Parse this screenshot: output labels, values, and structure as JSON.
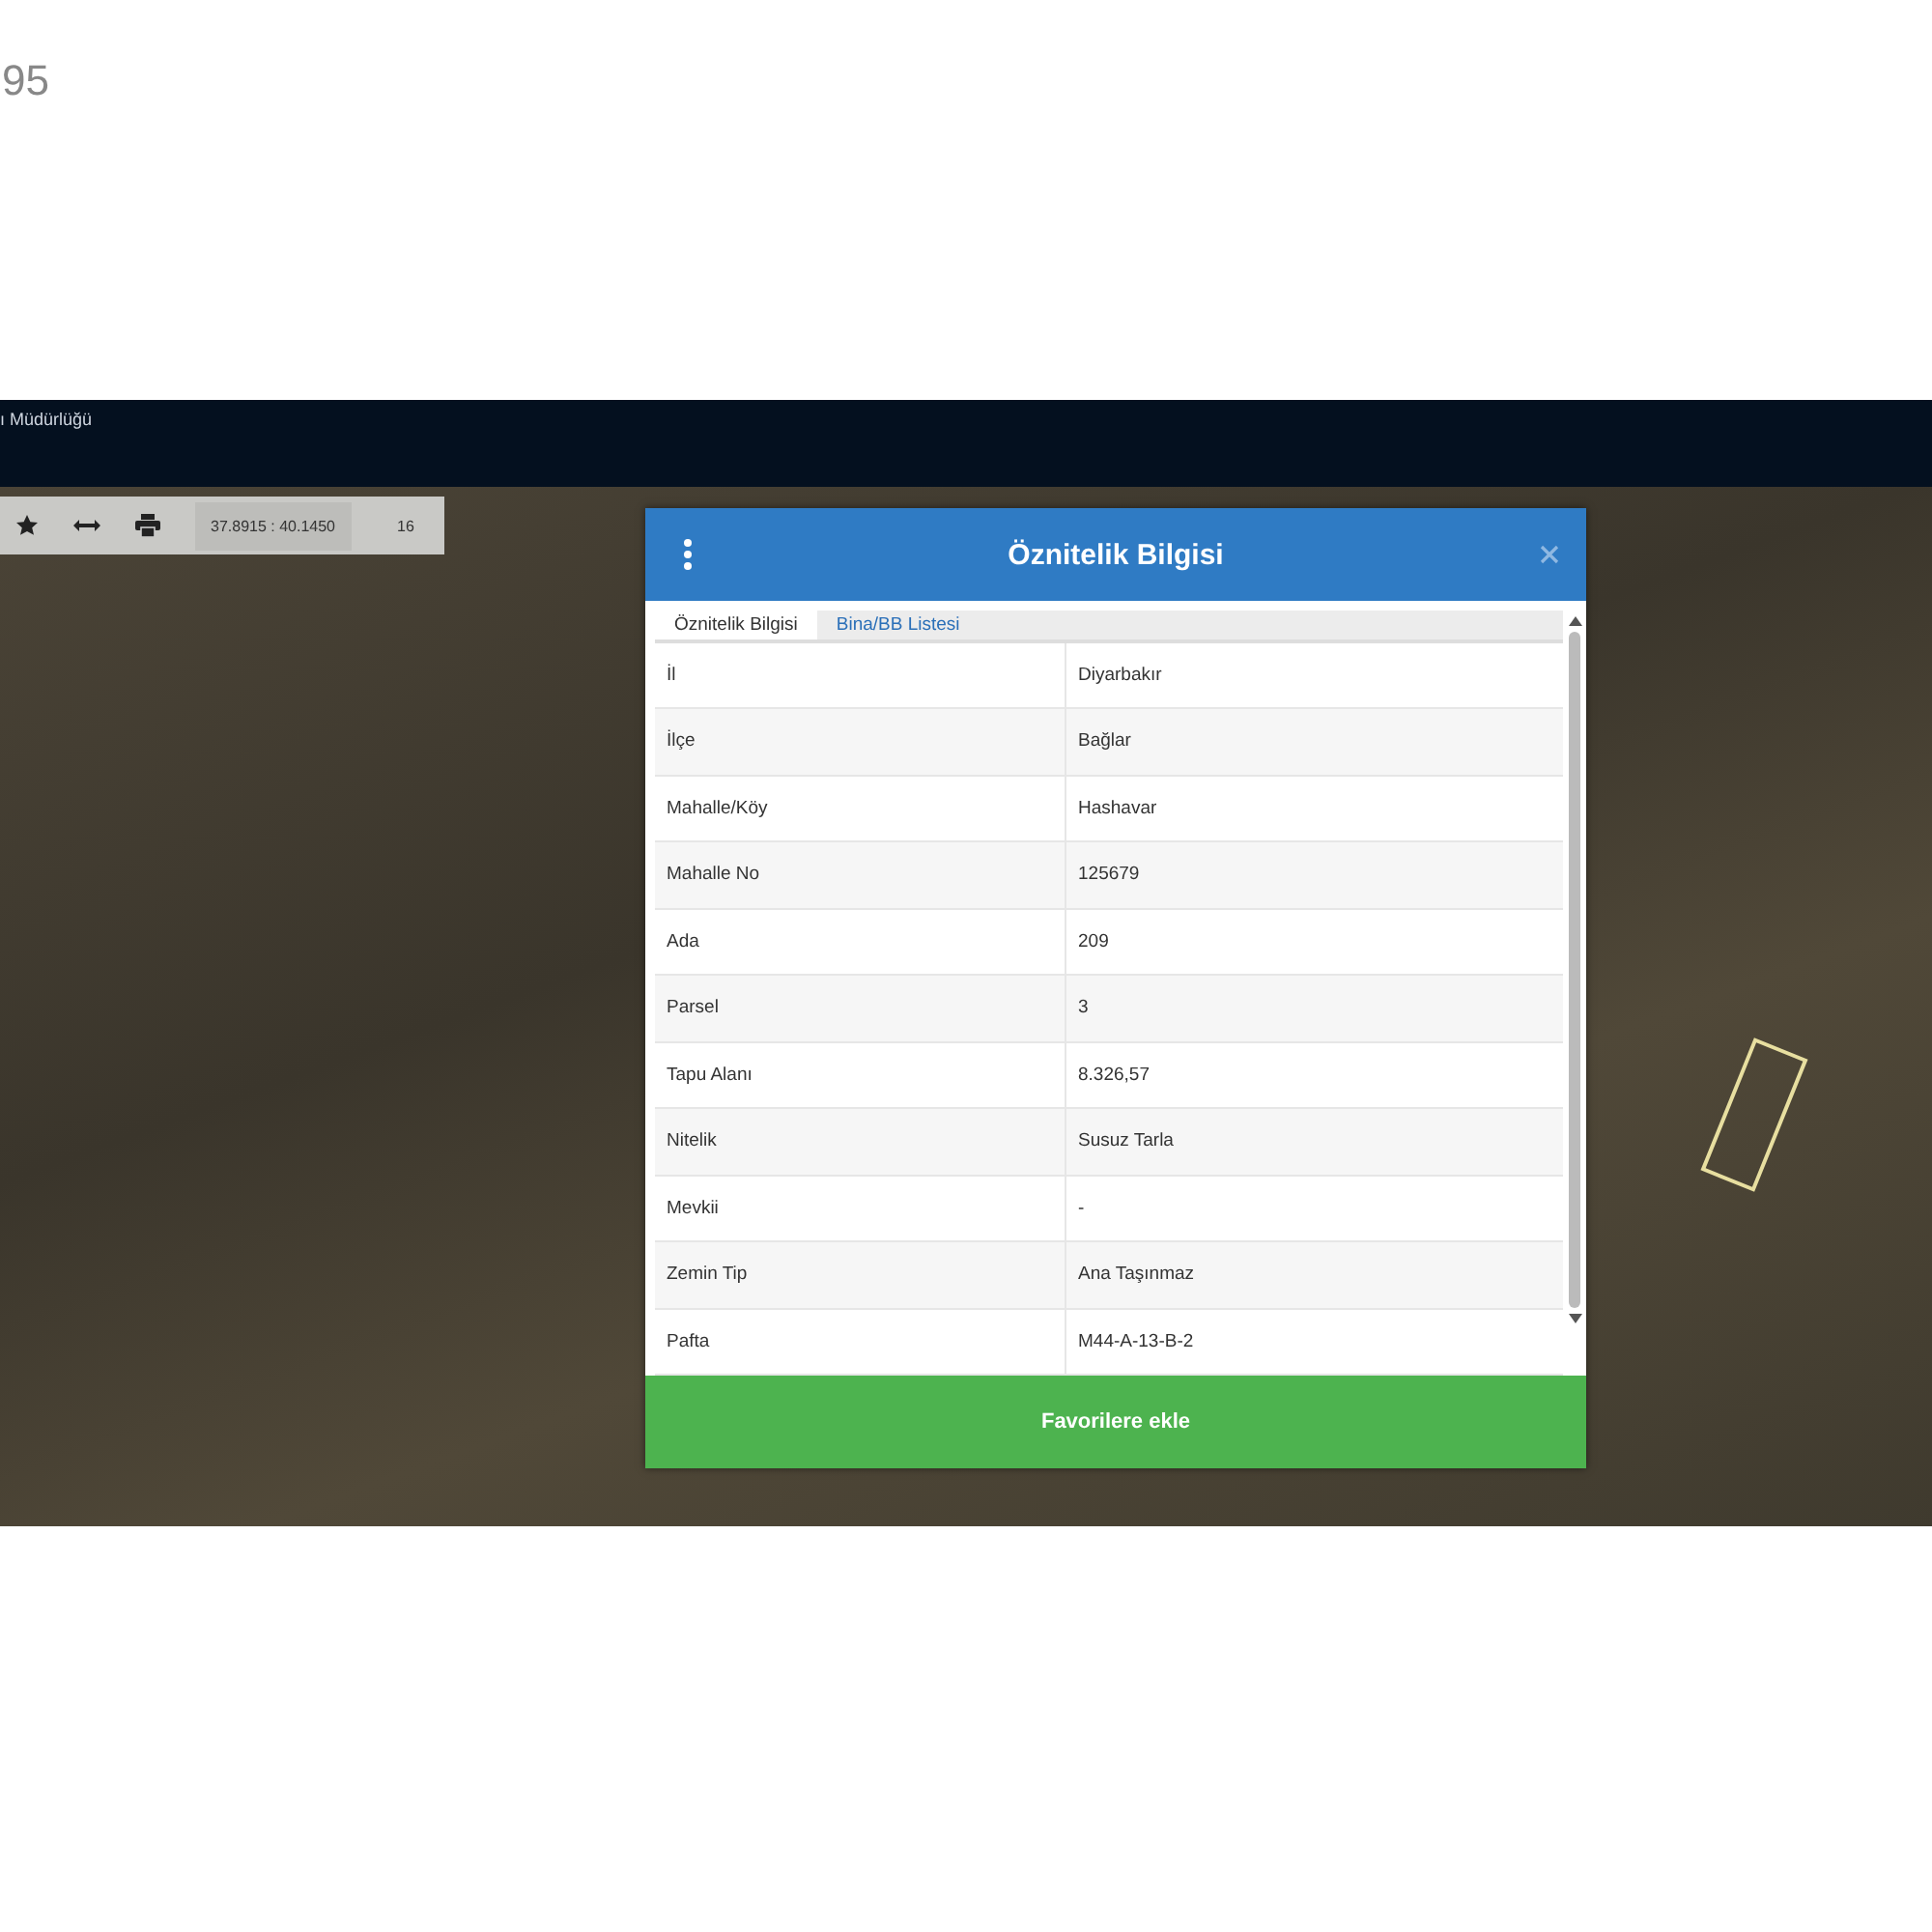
{
  "page_number": "95",
  "app_header": {
    "title": "ı Müdürlüğü"
  },
  "toolbar": {
    "coordinates": "37.8915 : 40.1450",
    "zoom": "16"
  },
  "dialog": {
    "title": "Öznitelik Bilgisi",
    "tabs": [
      {
        "label": "Öznitelik Bilgisi",
        "selected": true
      },
      {
        "label": "Bina/BB Listesi",
        "selected": false
      }
    ],
    "rows": [
      {
        "label": "İl",
        "value": "Diyarbakır"
      },
      {
        "label": "İlçe",
        "value": "Bağlar"
      },
      {
        "label": "Mahalle/Köy",
        "value": "Hashavar"
      },
      {
        "label": "Mahalle No",
        "value": "125679"
      },
      {
        "label": "Ada",
        "value": "209"
      },
      {
        "label": "Parsel",
        "value": "3"
      },
      {
        "label": "Tapu Alanı",
        "value": "8.326,57"
      },
      {
        "label": "Nitelik",
        "value": "Susuz Tarla"
      },
      {
        "label": "Mevkii",
        "value": "-"
      },
      {
        "label": "Zemin Tip",
        "value": "Ana Taşınmaz"
      },
      {
        "label": "Pafta",
        "value": "M44-A-13-B-2"
      }
    ],
    "button": "Favorilere ekle"
  }
}
